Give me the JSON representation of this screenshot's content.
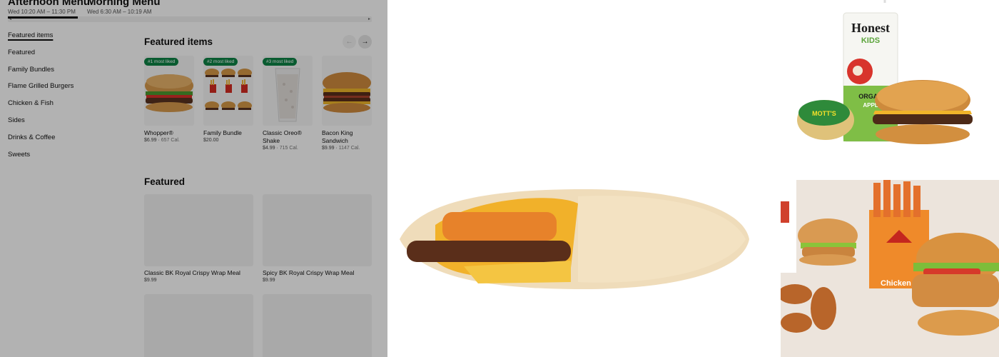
{
  "menu_tabs": [
    {
      "title": "Afternoon Menu",
      "time": "Wed 10:20 AM – 11:30 PM"
    },
    {
      "title": "Morning Menu",
      "time": "Wed 6:30 AM – 10:19 AM"
    }
  ],
  "categories": [
    "Featured items",
    "Featured",
    "Family Bundles",
    "Flame Grilled Burgers",
    "Chicken & Fish",
    "Sides",
    "Drinks & Coffee",
    "Sweets"
  ],
  "featured_items": {
    "title": "Featured items",
    "products": [
      {
        "badge": "#1 most liked",
        "name": "Whopper®",
        "price": "$6.99",
        "calories": "657 Cal."
      },
      {
        "badge": "#2 most liked",
        "name": "Family Bundle",
        "price": "$20.00",
        "calories": ""
      },
      {
        "badge": "#3 most liked",
        "name": "Classic Oreo® Shake",
        "price": "$4.99",
        "calories": "715 Cal."
      },
      {
        "badge": "",
        "name": "Bacon King Sandwich",
        "price": "$9.99",
        "calories": "1147 Cal."
      }
    ]
  },
  "featured": {
    "title": "Featured",
    "meals": [
      {
        "name": "Classic BK Royal Crispy Wrap Meal",
        "price": "$9.99"
      },
      {
        "name": "Spicy BK Royal Crispy Wrap  Meal",
        "price": "$9.99"
      },
      {
        "name": "",
        "price": ""
      },
      {
        "name": "",
        "price": ""
      }
    ]
  },
  "icons": {
    "carousel_prev": "arrow-left-icon",
    "carousel_next": "arrow-right-icon"
  },
  "images": {
    "kids_meal": {
      "brand_text": "Honest",
      "sub_text": "KIDS",
      "cup_text": "MOTT'S",
      "box_text": "ORGAN",
      "box_text2": "APPL"
    },
    "wrap": {},
    "chicken": {
      "box_text": "Chicken"
    }
  },
  "colors": {
    "badge_green": "#0e8345",
    "overlay": "rgba(0,0,0,0.30)"
  }
}
